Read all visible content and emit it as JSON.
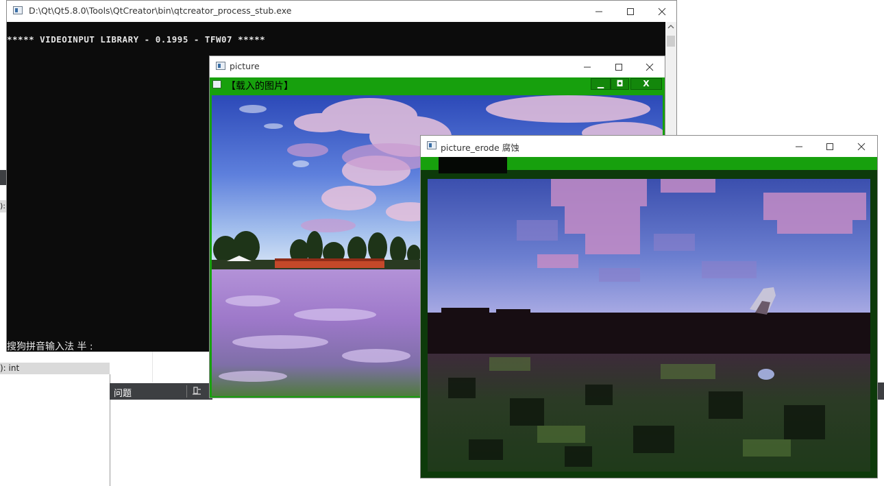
{
  "console": {
    "title": "D:\\Qt\\Qt5.8.0\\Tools\\QtCreator\\bin\\qtcreator_process_stub.exe",
    "line1": "***** VIDEOINPUT LIBRARY - 0.1995 - TFW07 *****",
    "ime_text": "搜狗拼音输入法 半 :"
  },
  "picture_window": {
    "title": "picture",
    "cv_title": "【载入的图片】",
    "btn_minimize": "▁",
    "btn_maximize": "◘",
    "btn_close": "X"
  },
  "erode_window": {
    "title": "picture_erode 腐蚀"
  },
  "ide_background": {
    "left_fragment": "):",
    "int_label": "): int",
    "issues_tab": "问题"
  },
  "colors": {
    "opencv_green": "#17a00d",
    "console_bg": "#0c0c0c",
    "ide_dark": "#3d3f42"
  }
}
